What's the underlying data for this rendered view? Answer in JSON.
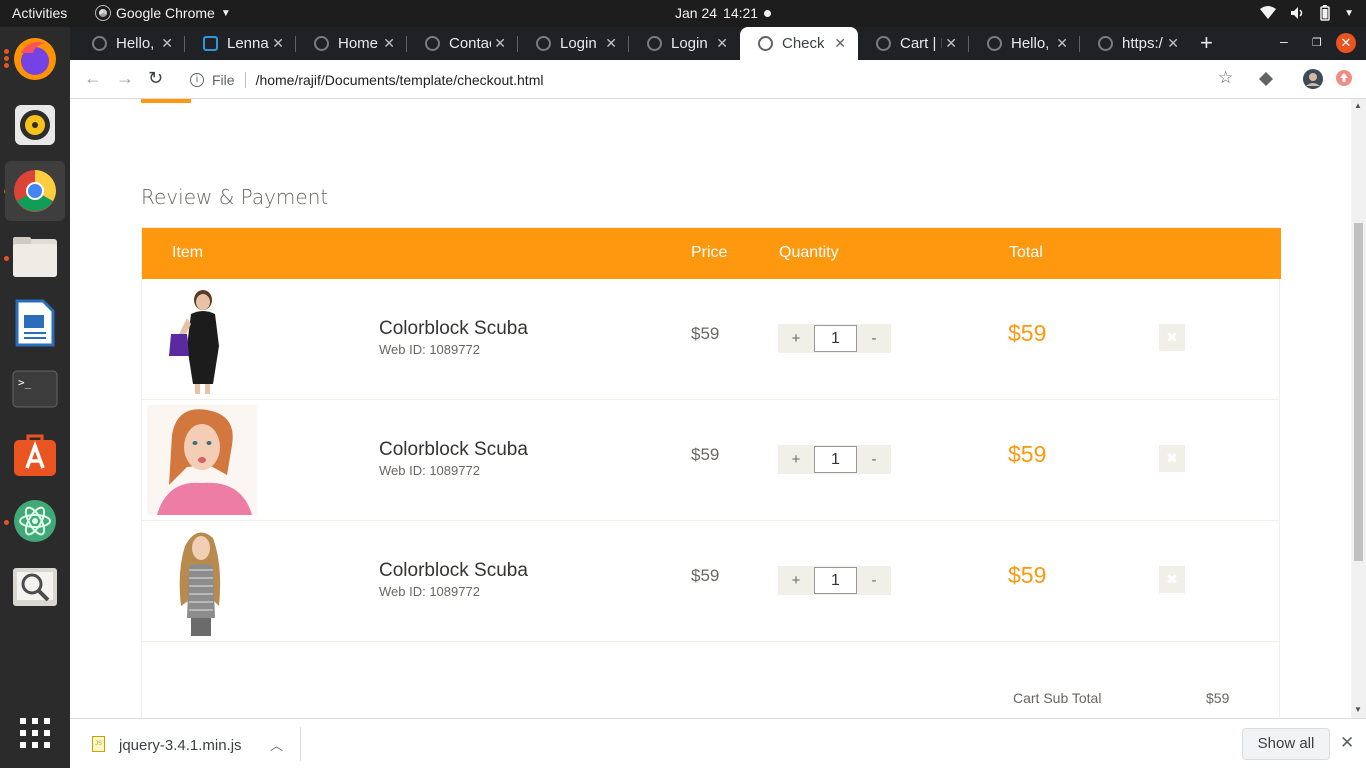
{
  "topbar": {
    "activities": "Activities",
    "app_name": "Google Chrome",
    "date": "Jan 24",
    "time": "14:21"
  },
  "dock": {
    "apps": [
      "firefox-icon",
      "rhythmbox-icon",
      "chrome-icon",
      "files-icon",
      "libreoffice-writer-icon",
      "terminal-icon",
      "software-center-icon",
      "atom-icon",
      "image-viewer-icon",
      "app-grid-icon"
    ]
  },
  "tabs": [
    {
      "title": "Hello, v"
    },
    {
      "title": "Lenna"
    },
    {
      "title": "Home |"
    },
    {
      "title": "Contac"
    },
    {
      "title": "Login |"
    },
    {
      "title": "Login |"
    },
    {
      "title": "Checko"
    },
    {
      "title": "Cart | E"
    },
    {
      "title": "Hello, v"
    },
    {
      "title": "https:/"
    }
  ],
  "toolbar": {
    "file_label": "File",
    "url": "/home/rajif/Documents/template/checkout.html"
  },
  "page": {
    "section_title": "Review & Payment",
    "headers": {
      "item": "Item",
      "price": "Price",
      "quantity": "Quantity",
      "total": "Total"
    },
    "items": [
      {
        "name": "Colorblock Scuba",
        "web_id": "Web ID: 1089772",
        "price": "$59",
        "qty": "1",
        "total": "$59",
        "plus": "+",
        "minus": "-",
        "delete": "✖"
      },
      {
        "name": "Colorblock Scuba",
        "web_id": "Web ID: 1089772",
        "price": "$59",
        "qty": "1",
        "total": "$59",
        "plus": "+",
        "minus": "-",
        "delete": "✖"
      },
      {
        "name": "Colorblock Scuba",
        "web_id": "Web ID: 1089772",
        "price": "$59",
        "qty": "1",
        "total": "$59",
        "plus": "+",
        "minus": "-",
        "delete": "✖"
      }
    ],
    "subtotal_label": "Cart Sub Total",
    "subtotal_value": "$59"
  },
  "downloads": {
    "filename": "jquery-3.4.1.min.js",
    "show_all": "Show all"
  },
  "colors": {
    "accent": "#fe980f",
    "topbar_bg": "#1d1d1d",
    "dock_bg": "#2b2b2b",
    "tabstrip_bg": "#202124"
  }
}
